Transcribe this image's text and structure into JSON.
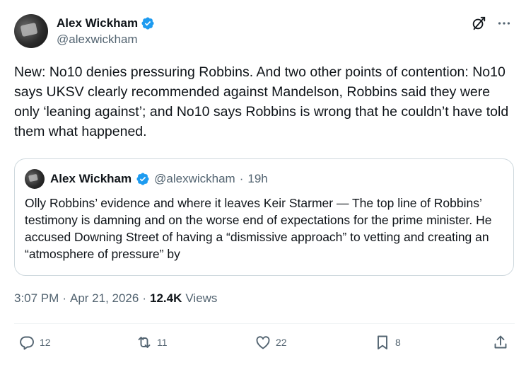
{
  "author": {
    "display_name": "Alex Wickham",
    "handle": "@alexwickham",
    "verified": true,
    "avatar_icon": "avatar"
  },
  "header_icons": [
    "grok-icon",
    "more-icon"
  ],
  "tweet": {
    "text": "New: No10 denies pressuring Robbins. And two other points of contention: No10 says UKSV clearly recommended against Mandelson, Robbins said they were only ‘leaning against’; and No10 says Robbins is wrong that he couldn’t have told them what happened."
  },
  "quoted_tweet": {
    "display_name": "Alex Wickham",
    "handle": "@alexwickham",
    "separator": "·",
    "time": "19h",
    "text": "Olly Robbins’ evidence and where it leaves Keir Starmer — The top line of Robbins’ testimony is damning and on the worse end of expectations for the prime minister. He accused Downing Street of having a “dismissive approach” to vetting and creating an “atmosphere of pressure” by"
  },
  "meta": {
    "time": "3:07 PM",
    "sep1": "·",
    "date": "Apr 21, 2026",
    "sep2": "·",
    "views_count": "12.4K",
    "views_label": "Views"
  },
  "actions": {
    "replies": "12",
    "reposts": "11",
    "likes": "22",
    "bookmarks": "8"
  },
  "colors": {
    "text": "#0f1419",
    "secondary": "#536471",
    "verified_blue": "#1d9bf0",
    "border": "#cfd9de"
  }
}
